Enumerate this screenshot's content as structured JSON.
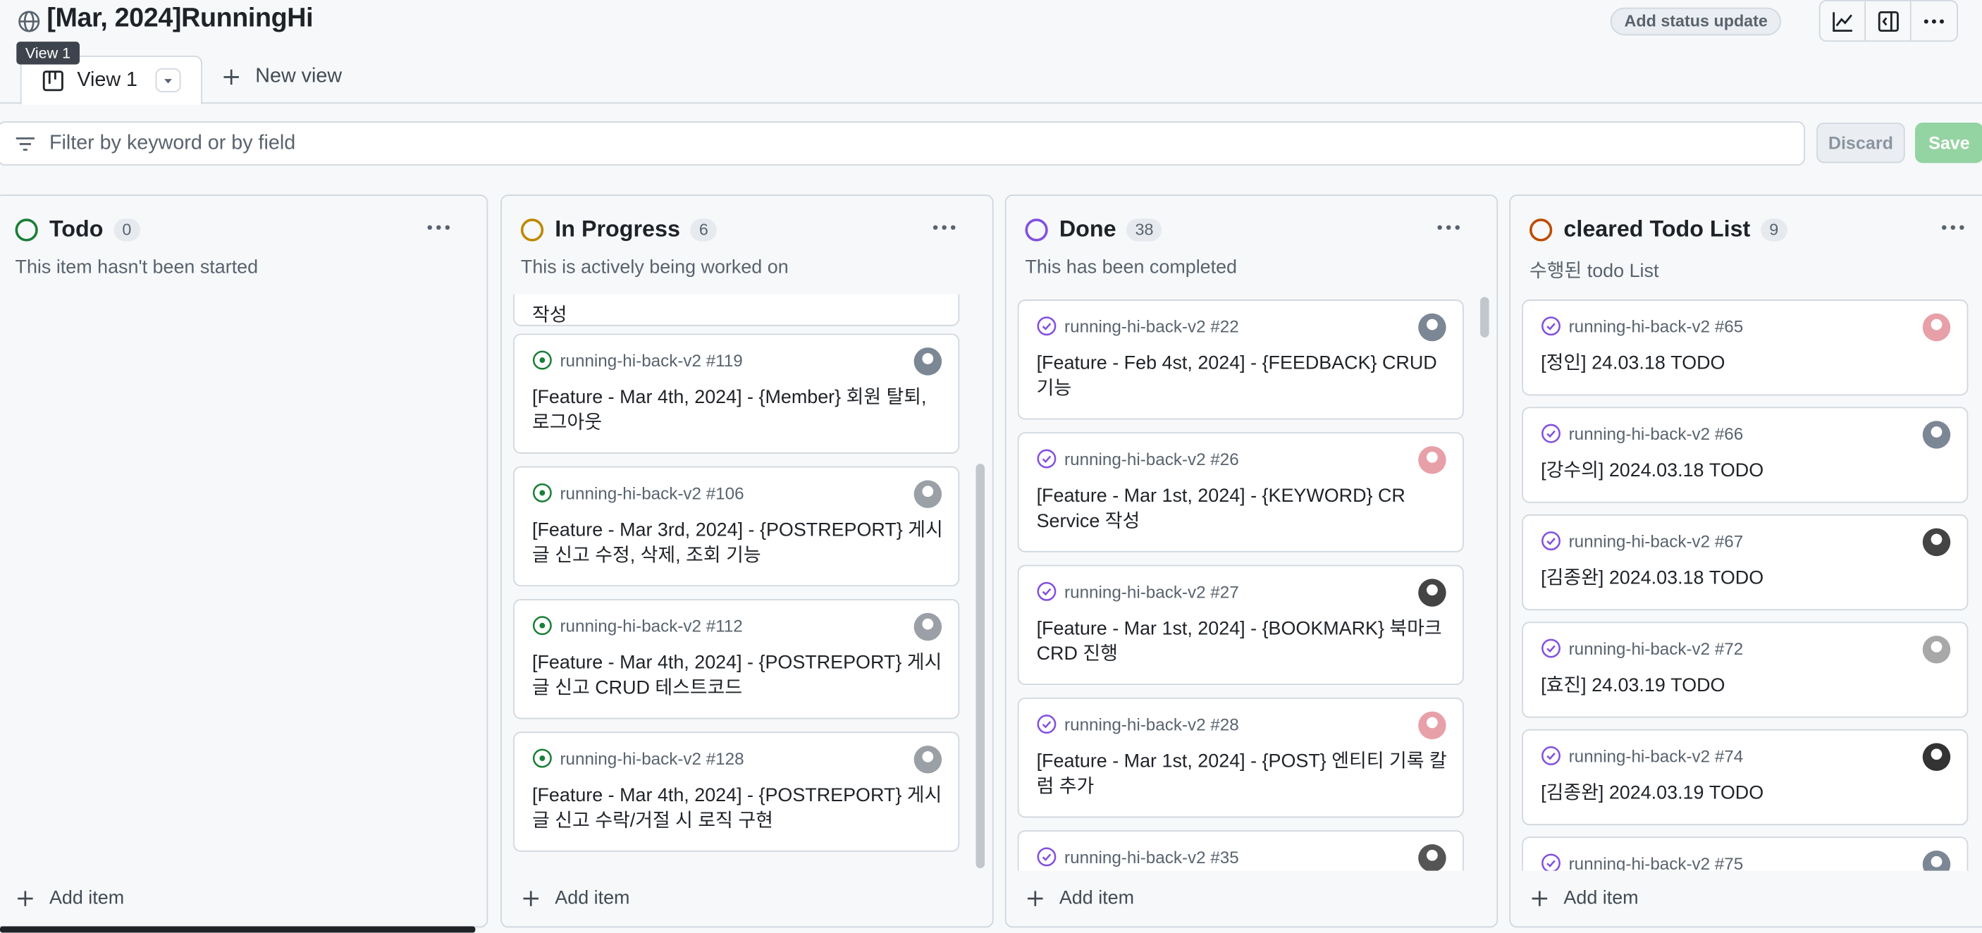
{
  "project": {
    "title": "[Mar, 2024]RunningHi",
    "status_update_label": "Add status update"
  },
  "tooltip": "View 1",
  "tabs": {
    "active_label": "View 1",
    "new_view_label": "New view"
  },
  "filter": {
    "placeholder": "Filter by keyword or by field",
    "discard_label": "Discard",
    "save_label": "Save"
  },
  "add_item_label": "Add item",
  "columns": [
    {
      "title": "Todo",
      "count": "0",
      "description": "This item hasn't been started",
      "color": "#1a7f37",
      "cards": []
    },
    {
      "title": "In Progress",
      "count": "6",
      "description": "This is actively being worked on",
      "color": "#bf8700",
      "partial_top_text": "작성",
      "cards": [
        {
          "ref": "running-hi-back-v2 #119",
          "title": "[Feature - Mar 4th, 2024] - {Member} 회원 탈퇴, 로그아웃"
        },
        {
          "ref": "running-hi-back-v2 #106",
          "title": "[Feature - Mar 3rd, 2024] - {POSTREPORT} 게시글 신고 수정, 삭제, 조회 기능"
        },
        {
          "ref": "running-hi-back-v2 #112",
          "title": "[Feature - Mar 4th, 2024] - {POSTREPORT} 게시글 신고 CRUD 테스트코드"
        },
        {
          "ref": "running-hi-back-v2 #128",
          "title": "[Feature - Mar 4th, 2024] - {POSTREPORT} 게시글 신고 수락/거절 시 로직 구현"
        }
      ]
    },
    {
      "title": "Done",
      "count": "38",
      "description": "This has been completed",
      "color": "#8250df",
      "cards": [
        {
          "ref": "running-hi-back-v2 #22",
          "title": "[Feature - Feb 4st, 2024] - {FEEDBACK} CRUD 기능"
        },
        {
          "ref": "running-hi-back-v2 #26",
          "title": "[Feature - Mar 1st, 2024] - {KEYWORD} CR Service 작성"
        },
        {
          "ref": "running-hi-back-v2 #27",
          "title": "[Feature - Mar 1st, 2024] - {BOOKMARK} 북마크 CRD 진행"
        },
        {
          "ref": "running-hi-back-v2 #28",
          "title": "[Feature - Mar 1st, 2024] - {POST} 엔티티 기록 칼럼 추가"
        },
        {
          "ref": "running-hi-back-v2 #35",
          "title": ""
        }
      ]
    },
    {
      "title": "cleared Todo List",
      "count": "9",
      "description": "수행된 todo List",
      "color": "#bc4c00",
      "cards": [
        {
          "ref": "running-hi-back-v2 #65",
          "title": "[정인] 24.03.18 TODO"
        },
        {
          "ref": "running-hi-back-v2 #66",
          "title": "[강수의] 2024.03.18 TODO"
        },
        {
          "ref": "running-hi-back-v2 #67",
          "title": "[김종완] 2024.03.18 TODO"
        },
        {
          "ref": "running-hi-back-v2 #72",
          "title": "[효진] 24.03.19 TODO"
        },
        {
          "ref": "running-hi-back-v2 #74",
          "title": "[김종완] 2024.03.19 TODO"
        },
        {
          "ref": "running-hi-back-v2 #75",
          "title": ""
        }
      ]
    }
  ]
}
